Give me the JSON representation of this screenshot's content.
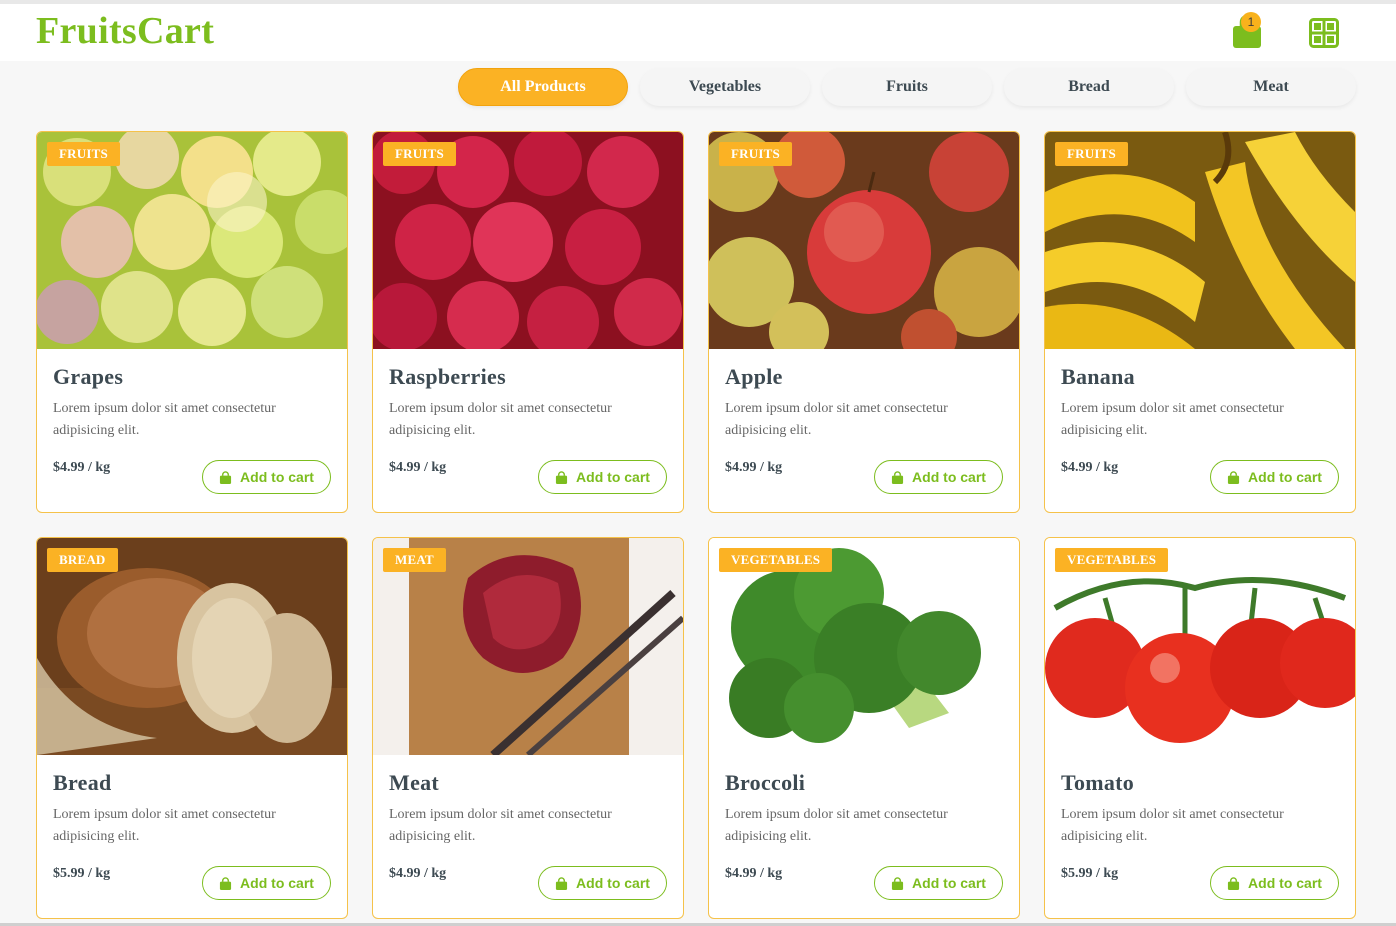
{
  "brand": "FruitsCart",
  "header": {
    "cart_count": "1",
    "cart_icon": "shopping-bag-icon",
    "grid_icon": "grid-view-icon"
  },
  "tabs": [
    {
      "label": "All Products",
      "active": true
    },
    {
      "label": "Vegetables",
      "active": false
    },
    {
      "label": "Fruits",
      "active": false
    },
    {
      "label": "Bread",
      "active": false
    },
    {
      "label": "Meat",
      "active": false
    }
  ],
  "products": [
    {
      "badge": "FRUITS",
      "title": "Grapes",
      "desc": "Lorem ipsum dolor sit amet consectetur adipisicing elit.",
      "price": "$4.99 / kg",
      "button": "Add to cart"
    },
    {
      "badge": "FRUITS",
      "title": "Raspberries",
      "desc": "Lorem ipsum dolor sit amet consectetur adipisicing elit.",
      "price": "$4.99 / kg",
      "button": "Add to cart"
    },
    {
      "badge": "FRUITS",
      "title": "Apple",
      "desc": "Lorem ipsum dolor sit amet consectetur adipisicing elit.",
      "price": "$4.99 / kg",
      "button": "Add to cart"
    },
    {
      "badge": "FRUITS",
      "title": "Banana",
      "desc": "Lorem ipsum dolor sit amet consectetur adipisicing elit.",
      "price": "$4.99 / kg",
      "button": "Add to cart"
    },
    {
      "badge": "BREAD",
      "title": "Bread",
      "desc": "Lorem ipsum dolor sit amet consectetur adipisicing elit.",
      "price": "$5.99 / kg",
      "button": "Add to cart"
    },
    {
      "badge": "MEAT",
      "title": "Meat",
      "desc": "Lorem ipsum dolor sit amet consectetur adipisicing elit.",
      "price": "$4.99 / kg",
      "button": "Add to cart"
    },
    {
      "badge": "VEGETABLES",
      "title": "Broccoli",
      "desc": "Lorem ipsum dolor sit amet consectetur adipisicing elit.",
      "price": "$4.99 / kg",
      "button": "Add to cart"
    },
    {
      "badge": "VEGETABLES",
      "title": "Tomato",
      "desc": "Lorem ipsum dolor sit amet consectetur adipisicing elit.",
      "price": "$5.99 / kg",
      "button": "Add to cart"
    }
  ],
  "colors": {
    "brand_green": "#7cbd1e",
    "accent_orange": "#fbb224",
    "card_border": "#f5c24a"
  }
}
